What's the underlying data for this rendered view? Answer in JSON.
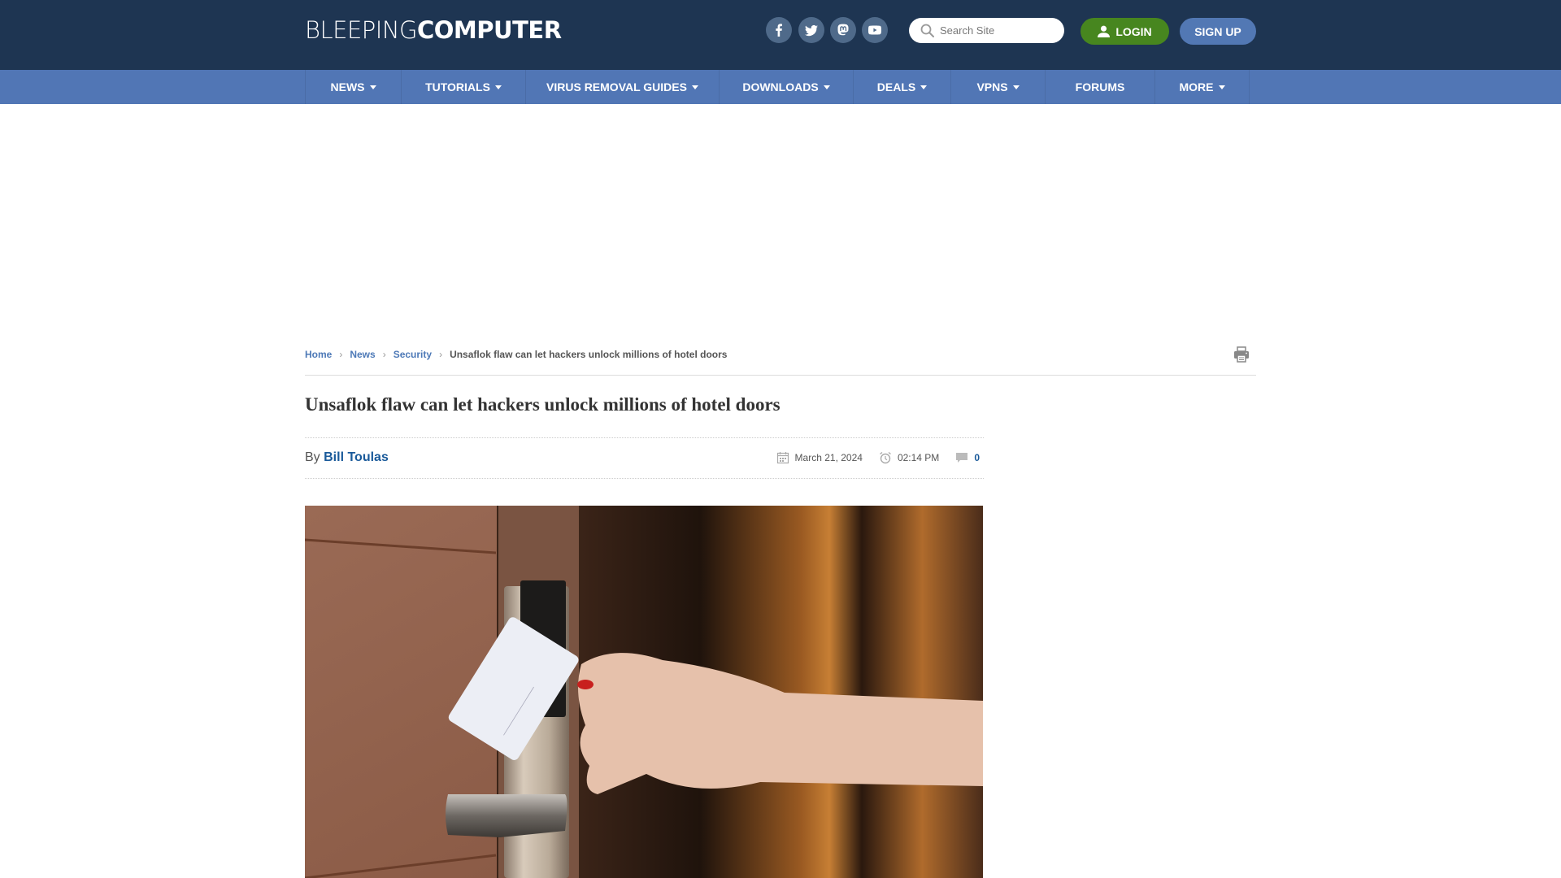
{
  "header": {
    "logo_light": "BLEEPING",
    "logo_bold": "COMPUTER",
    "social": [
      {
        "name": "facebook",
        "icon": "facebook-icon"
      },
      {
        "name": "twitter",
        "icon": "twitter-icon"
      },
      {
        "name": "mastodon",
        "icon": "mastodon-icon"
      },
      {
        "name": "youtube",
        "icon": "youtube-icon"
      }
    ],
    "search_placeholder": "Search Site",
    "login_label": "LOGIN",
    "signup_label": "SIGN UP"
  },
  "nav": {
    "items": [
      {
        "label": "NEWS",
        "dropdown": true
      },
      {
        "label": "TUTORIALS",
        "dropdown": true
      },
      {
        "label": "VIRUS REMOVAL GUIDES",
        "dropdown": true
      },
      {
        "label": "DOWNLOADS",
        "dropdown": true
      },
      {
        "label": "DEALS",
        "dropdown": true
      },
      {
        "label": "VPNS",
        "dropdown": true
      },
      {
        "label": "FORUMS",
        "dropdown": false
      },
      {
        "label": "MORE",
        "dropdown": true
      }
    ]
  },
  "breadcrumb": {
    "items": [
      "Home",
      "News",
      "Security"
    ],
    "current": "Unsaflok flaw can let hackers unlock millions of hotel doors"
  },
  "article": {
    "title": "Unsaflok flaw can let hackers unlock millions of hotel doors",
    "by_label": "By",
    "author": "Bill Toulas",
    "date": "March 21, 2024",
    "time": "02:14 PM",
    "comments": "0",
    "image_alt": "Hand holding a hotel key card against an RFID door lock"
  },
  "colors": {
    "topbar": "#1e3552",
    "navbar": "#5176b5",
    "login": "#47861f",
    "signup": "#5278b4",
    "link": "#4d79b7"
  }
}
